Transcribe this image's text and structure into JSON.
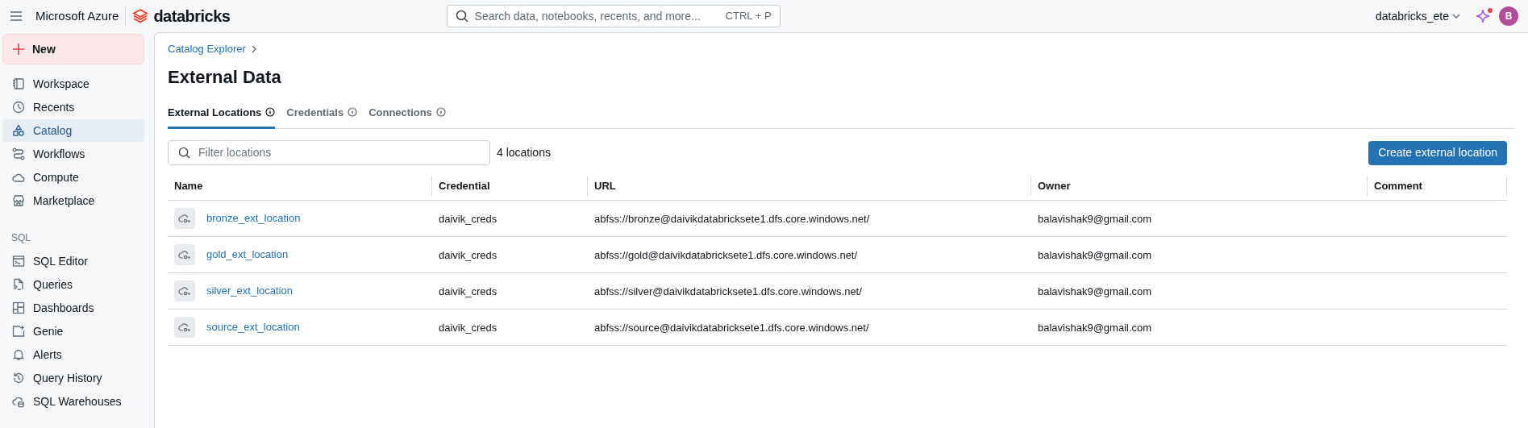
{
  "top_bar": {
    "brand": "Microsoft Azure",
    "product": "databricks",
    "search": {
      "placeholder": "Search data, notebooks, recents, and more...",
      "shortcut": "CTRL + P"
    },
    "workspace": "databricks_ete",
    "assistant_notification": true,
    "avatar": "B"
  },
  "sidebar": {
    "new_button": "New",
    "items": [
      {
        "label": "Workspace",
        "selected": false
      },
      {
        "label": "Recents",
        "selected": false
      },
      {
        "label": "Catalog",
        "selected": true
      },
      {
        "label": "Workflows",
        "selected": false
      },
      {
        "label": "Compute",
        "selected": false
      },
      {
        "label": "Marketplace",
        "selected": false
      }
    ],
    "section": "SQL",
    "sql_items": [
      {
        "label": "SQL Editor",
        "selected": false
      },
      {
        "label": "Queries",
        "selected": false
      },
      {
        "label": "Dashboards",
        "selected": false
      },
      {
        "label": "Genie",
        "selected": false
      },
      {
        "label": "Alerts",
        "selected": false
      },
      {
        "label": "Query History",
        "selected": false
      },
      {
        "label": "SQL Warehouses",
        "selected": false
      }
    ]
  },
  "breadcrumb": "Catalog Explorer",
  "title": "External Data",
  "tabs": [
    {
      "label": "External Locations",
      "selected": true
    },
    {
      "label": "Credentials",
      "selected": false
    },
    {
      "label": "Connections",
      "selected": false
    }
  ],
  "filter": {
    "placeholder": "Filter locations"
  },
  "count": "4 locations",
  "create_button": "Create external location",
  "table": {
    "columns": [
      "Name",
      "Credential",
      "URL",
      "Owner",
      "Comment"
    ],
    "rows": [
      {
        "name": "bronze_ext_location",
        "credential": "daivik_creds",
        "url": "abfss://bronze@daivikdatabricksete1.dfs.core.windows.net/",
        "owner": "balavishak9@gmail.com"
      },
      {
        "name": "gold_ext_location",
        "credential": "daivik_creds",
        "url": "abfss://gold@daivikdatabricksete1.dfs.core.windows.net/",
        "owner": "balavishak9@gmail.com"
      },
      {
        "name": "silver_ext_location",
        "credential": "daivik_creds",
        "url": "abfss://silver@daivikdatabricksete1.dfs.core.windows.net/",
        "owner": "balavishak9@gmail.com"
      },
      {
        "name": "source_ext_location",
        "credential": "daivik_creds",
        "url": "abfss://source@daivikdatabricksete1.dfs.core.windows.net/",
        "owner": "balavishak9@gmail.com"
      }
    ]
  }
}
